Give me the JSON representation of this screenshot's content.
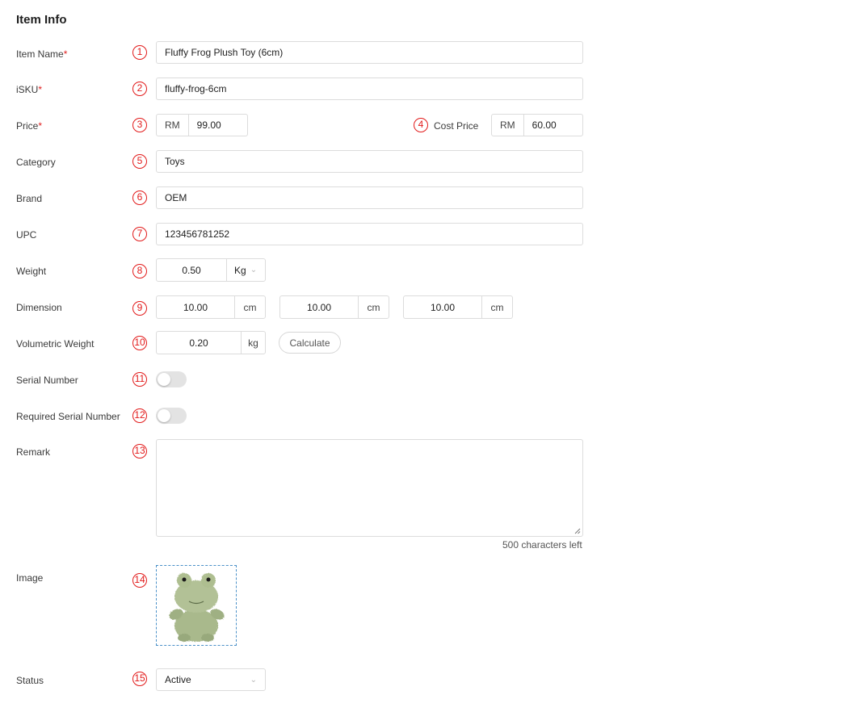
{
  "section_title": "Item Info",
  "required_mark": "*",
  "fields": {
    "item_name": {
      "label": "Item Name",
      "badge": "1",
      "value": "Fluffy Frog Plush Toy (6cm)"
    },
    "isku": {
      "label": "iSKU",
      "badge": "2",
      "value": "fluffy-frog-6cm"
    },
    "price": {
      "label": "Price",
      "badge": "3",
      "currency": "RM",
      "value": "99.00"
    },
    "cost_price": {
      "label": "Cost Price",
      "badge": "4",
      "currency": "RM",
      "value": "60.00"
    },
    "category": {
      "label": "Category",
      "badge": "5",
      "value": "Toys"
    },
    "brand": {
      "label": "Brand",
      "badge": "6",
      "value": "OEM"
    },
    "upc": {
      "label": "UPC",
      "badge": "7",
      "value": "123456781252"
    },
    "weight": {
      "label": "Weight",
      "badge": "8",
      "value": "0.50",
      "unit": "Kg"
    },
    "dimension": {
      "label": "Dimension",
      "badge": "9",
      "values": [
        {
          "value": "10.00",
          "unit": "cm"
        },
        {
          "value": "10.00",
          "unit": "cm"
        },
        {
          "value": "10.00",
          "unit": "cm"
        }
      ]
    },
    "volumetric_weight": {
      "label": "Volumetric Weight",
      "badge": "10",
      "value": "0.20",
      "unit": "kg",
      "button": "Calculate"
    },
    "serial_number": {
      "label": "Serial Number",
      "badge": "11",
      "enabled": false
    },
    "required_serial_number": {
      "label": "Required Serial Number",
      "badge": "12",
      "enabled": false
    },
    "remark": {
      "label": "Remark",
      "badge": "13",
      "value": "",
      "counter": "500 characters left"
    },
    "image": {
      "label": "Image",
      "badge": "14",
      "icon": "frog-plush-image"
    },
    "status": {
      "label": "Status",
      "badge": "15",
      "value": "Active"
    }
  },
  "colors": {
    "badge": "#e21a1a",
    "required": "#e02020",
    "border": "#dcdcdc",
    "toggle_off": "#e3e3e3",
    "image_border": "#4a90c8"
  }
}
